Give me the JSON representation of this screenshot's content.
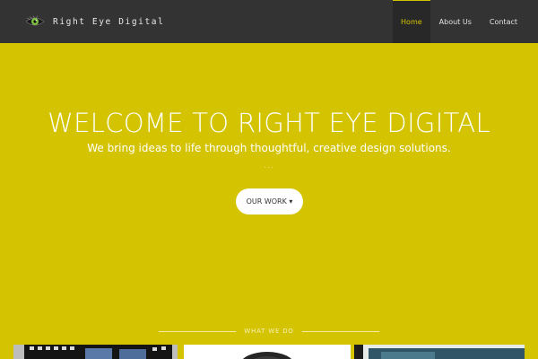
{
  "brand": {
    "name": "Right Eye Digital",
    "logo_icon": "eye-icon",
    "iris_color": "#7fc241"
  },
  "nav": {
    "items": [
      {
        "label": "Home",
        "active": true
      },
      {
        "label": "About Us",
        "active": false
      },
      {
        "label": "Contact",
        "active": false
      }
    ]
  },
  "hero": {
    "title": "WELCOME TO RIGHT EYE DIGITAL",
    "subtitle": "We bring ideas to life through thoughtful, creative design solutions.",
    "separator": "...",
    "cta_label": "OUR WORK ▾"
  },
  "section": {
    "label": "WHAT WE DO"
  },
  "colors": {
    "accent": "#d4c300",
    "navbar": "#333333",
    "nav_active_bg": "#282828",
    "text_light": "#ffffff"
  }
}
